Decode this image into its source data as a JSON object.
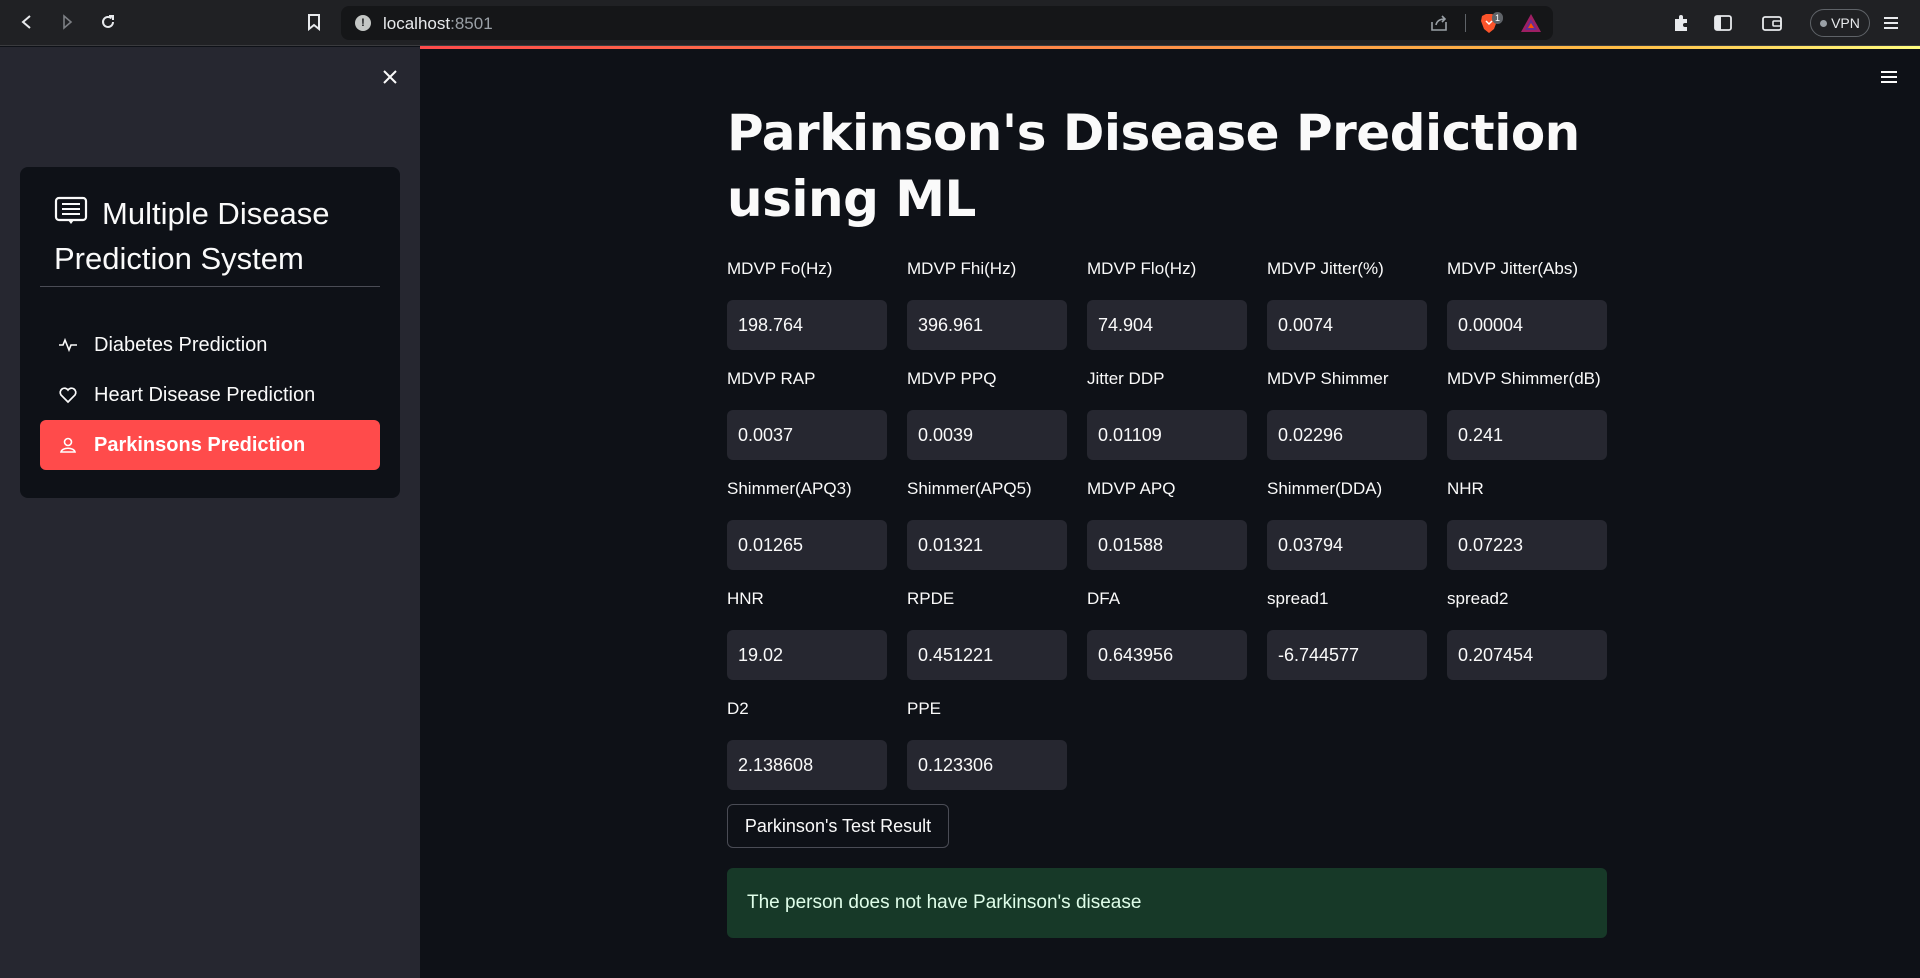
{
  "browser": {
    "url_host": "localhost",
    "url_port": ":8501",
    "brave_badge": "1",
    "vpn_label": "VPN"
  },
  "sidebar": {
    "title": "Multiple Disease Prediction System",
    "items": [
      {
        "label": "Diabetes Prediction",
        "icon": "activity-icon",
        "active": false
      },
      {
        "label": "Heart Disease Prediction",
        "icon": "heart-icon",
        "active": false
      },
      {
        "label": "Parkinsons Prediction",
        "icon": "person-icon",
        "active": true
      }
    ]
  },
  "main": {
    "title": "Parkinson's Disease Prediction using ML",
    "fields": [
      {
        "label": "MDVP Fo(Hz)",
        "value": "198.764"
      },
      {
        "label": "MDVP Fhi(Hz)",
        "value": "396.961"
      },
      {
        "label": "MDVP Flo(Hz)",
        "value": "74.904"
      },
      {
        "label": "MDVP Jitter(%)",
        "value": "0.0074"
      },
      {
        "label": "MDVP Jitter(Abs)",
        "value": "0.00004"
      },
      {
        "label": "MDVP RAP",
        "value": "0.0037"
      },
      {
        "label": "MDVP PPQ",
        "value": "0.0039"
      },
      {
        "label": "Jitter DDP",
        "value": "0.01109"
      },
      {
        "label": "MDVP Shimmer",
        "value": "0.02296"
      },
      {
        "label": "MDVP Shimmer(dB)",
        "value": "0.241"
      },
      {
        "label": "Shimmer(APQ3)",
        "value": "0.01265"
      },
      {
        "label": "Shimmer(APQ5)",
        "value": "0.01321"
      },
      {
        "label": "MDVP APQ",
        "value": "0.01588"
      },
      {
        "label": "Shimmer(DDA)",
        "value": "0.03794"
      },
      {
        "label": "NHR",
        "value": "0.07223"
      },
      {
        "label": "HNR",
        "value": "19.02"
      },
      {
        "label": "RPDE",
        "value": "0.451221"
      },
      {
        "label": "DFA",
        "value": "0.643956"
      },
      {
        "label": "spread1",
        "value": "-6.744577"
      },
      {
        "label": "spread2",
        "value": "0.207454"
      },
      {
        "label": "D2",
        "value": "2.138608"
      },
      {
        "label": "PPE",
        "value": "0.123306"
      }
    ],
    "button_label": "Parkinson's Test Result",
    "result_message": "The person does not have Parkinson's disease"
  },
  "colors": {
    "background": "#0e1117",
    "sidebar": "#262730",
    "accent": "#ff4b4b",
    "success_bg": "#173928"
  }
}
